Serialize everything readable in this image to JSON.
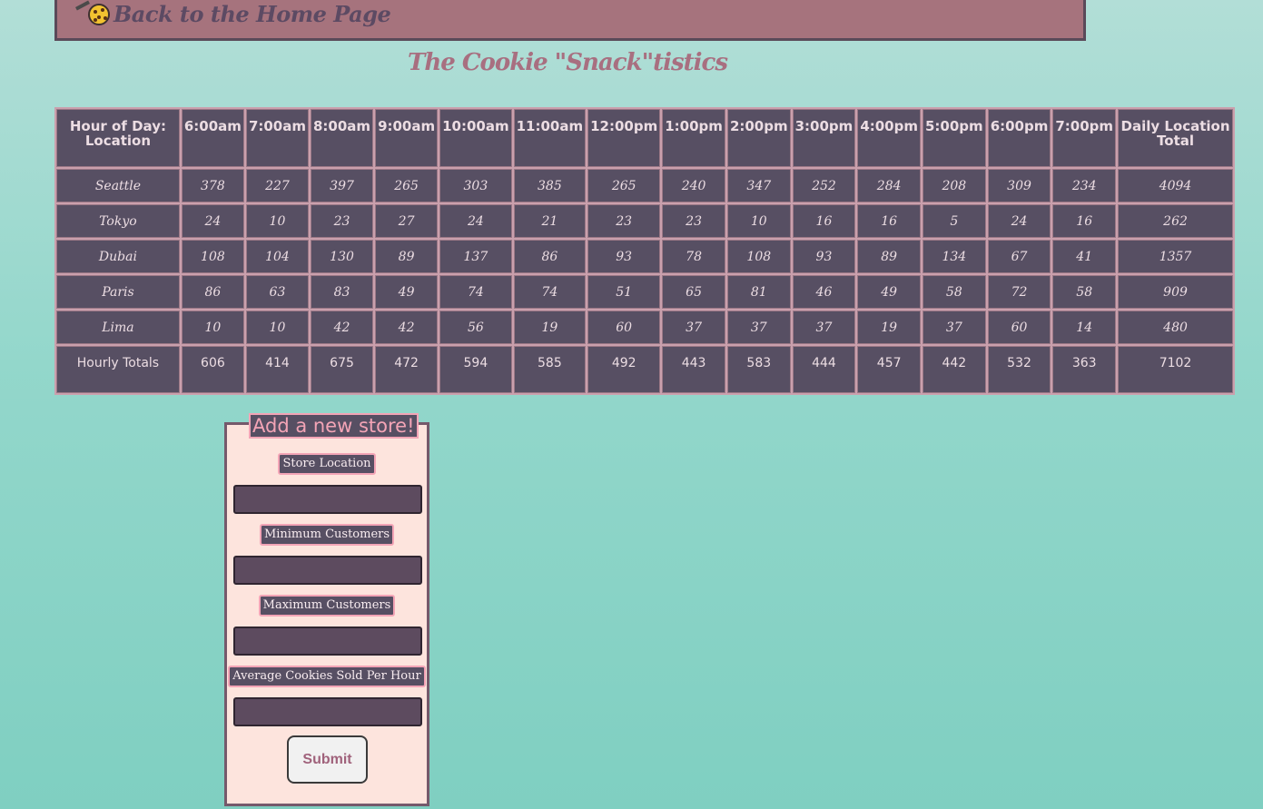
{
  "nav": {
    "home_link": "Back to the Home Page"
  },
  "page": {
    "title": "The Cookie \"Snack\"tistics"
  },
  "table": {
    "corner_header": "Hour of Day: Location",
    "hours": [
      "6:00am",
      "7:00am",
      "8:00am",
      "9:00am",
      "10:00am",
      "11:00am",
      "12:00pm",
      "1:00pm",
      "2:00pm",
      "3:00pm",
      "4:00pm",
      "5:00pm",
      "6:00pm",
      "7:00pm"
    ],
    "total_header": "Daily Location Total",
    "rows": [
      {
        "location": "Seattle",
        "values": [
          "378",
          "227",
          "397",
          "265",
          "303",
          "385",
          "265",
          "240",
          "347",
          "252",
          "284",
          "208",
          "309",
          "234"
        ],
        "total": "4094"
      },
      {
        "location": "Tokyo",
        "values": [
          "24",
          "10",
          "23",
          "27",
          "24",
          "21",
          "23",
          "23",
          "10",
          "16",
          "16",
          "5",
          "24",
          "16"
        ],
        "total": "262"
      },
      {
        "location": "Dubai",
        "values": [
          "108",
          "104",
          "130",
          "89",
          "137",
          "86",
          "93",
          "78",
          "108",
          "93",
          "89",
          "134",
          "67",
          "41"
        ],
        "total": "1357"
      },
      {
        "location": "Paris",
        "values": [
          "86",
          "63",
          "83",
          "49",
          "74",
          "74",
          "51",
          "65",
          "81",
          "46",
          "49",
          "58",
          "72",
          "58"
        ],
        "total": "909"
      },
      {
        "location": "Lima",
        "values": [
          "10",
          "10",
          "42",
          "42",
          "56",
          "19",
          "60",
          "37",
          "37",
          "37",
          "19",
          "37",
          "60",
          "14"
        ],
        "total": "480"
      }
    ],
    "totals": {
      "label": "Hourly Totals",
      "values": [
        "606",
        "414",
        "675",
        "472",
        "594",
        "585",
        "492",
        "443",
        "583",
        "444",
        "457",
        "442",
        "532",
        "363"
      ],
      "grand_total": "7102"
    }
  },
  "form": {
    "legend": "Add a new store!",
    "location_label": "Store Location",
    "location_value": "",
    "min_label": "Minimum Customers",
    "min_value": "",
    "max_label": "Maximum Customers",
    "max_value": "",
    "avg_label": "Average Cookies Sold Per Hour",
    "avg_value": "",
    "submit_label": "Submit"
  },
  "colors": {
    "background": "#93d7cb",
    "header_bar": "#a6737d",
    "table_cell": "#574f63",
    "table_border": "#caa0ad",
    "title": "#a86f80",
    "form_background": "#fde4dd",
    "accent_pink": "#f3a4b6"
  },
  "icons": {
    "home_link_icon": "cookie-icon",
    "pencil_icon": "pencil-icon"
  }
}
